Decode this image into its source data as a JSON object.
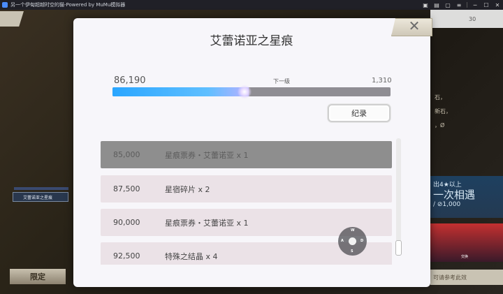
{
  "window": {
    "title": "另一个伊甸超越时空的猫-Powered by MuMu模拟器",
    "controls": [
      "minimize-icon",
      "maximize-icon",
      "close-icon"
    ]
  },
  "background": {
    "left_banner": "艾蕾诺亚之星痕",
    "limit_label": "限定",
    "right_top_value": "30",
    "right_side_lines": [
      "石，",
      "新石，",
      "，Ø"
    ],
    "right_panel": {
      "line1": "出4★以上",
      "line2": "一次相遇",
      "line3": "/ ⊘1,000"
    },
    "card_label": "交换",
    "right_bottom": "可请参考此效"
  },
  "dialog": {
    "title": "艾蕾诺亚之星痕",
    "close_icon": "close-icon",
    "progress": {
      "current": "86,190",
      "next_label": "下一级",
      "next_remaining": "1,310",
      "fill_fraction": 0.49
    },
    "record_button": "纪录",
    "rows": [
      {
        "points": "85,000",
        "reward": "星痕票券・艾蕾诺亚 x 1",
        "claimed": true
      },
      {
        "points": "87,500",
        "reward": "星宿碎片 x 2",
        "claimed": false
      },
      {
        "points": "90,000",
        "reward": "星痕票券・艾蕾诺亚 x 1",
        "claimed": false
      },
      {
        "points": "92,500",
        "reward": "特殊之结晶 x 4",
        "claimed": false
      }
    ]
  },
  "overlay": {
    "dpad_keys": {
      "up": "W",
      "left": "A",
      "right": "D",
      "down": "S"
    }
  },
  "colors": {
    "progress_fill": "#2aa6ff",
    "claimed_row": "#8e8e8e",
    "row": "#ebe2e7",
    "dialog_bg": "#f7f6fa"
  }
}
